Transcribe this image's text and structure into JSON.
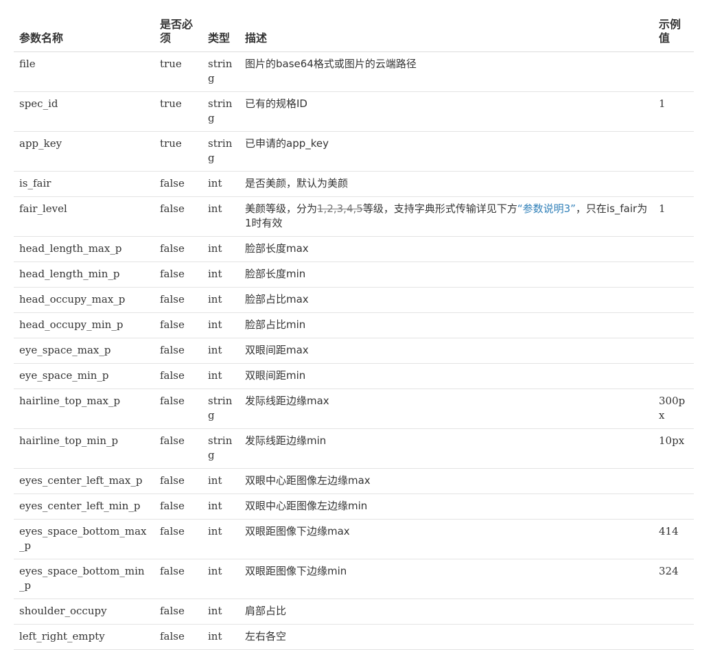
{
  "headers": {
    "name": "参数名称",
    "required": "是否必须",
    "type": "类型",
    "description": "描述",
    "example": "示例值"
  },
  "rows": [
    {
      "name": "file",
      "required": "true",
      "type": "string",
      "description": "图片的base64格式或图片的云端路径",
      "example": ""
    },
    {
      "name": "spec_id",
      "required": "true",
      "type": "string",
      "description": "已有的规格ID",
      "example": "1"
    },
    {
      "name": "app_key",
      "required": "true",
      "type": "string",
      "description": "已申请的app_key",
      "example": ""
    },
    {
      "name": "is_fair",
      "required": "false",
      "type": "int",
      "description": "是否美颜，默认为美颜",
      "example": ""
    },
    {
      "name": "fair_level",
      "required": "false",
      "type": "int",
      "description": "",
      "example": "1"
    },
    {
      "name": "head_length_max_p",
      "required": "false",
      "type": "int",
      "description": "脸部长度max",
      "example": ""
    },
    {
      "name": "head_length_min_p",
      "required": "false",
      "type": "int",
      "description": "脸部长度min",
      "example": ""
    },
    {
      "name": "head_occupy_max_p",
      "required": "false",
      "type": "int",
      "description": "脸部占比max",
      "example": ""
    },
    {
      "name": "head_occupy_min_p",
      "required": "false",
      "type": "int",
      "description": "脸部占比min",
      "example": ""
    },
    {
      "name": "eye_space_max_p",
      "required": "false",
      "type": "int",
      "description": "双眼间距max",
      "example": ""
    },
    {
      "name": "eye_space_min_p",
      "required": "false",
      "type": "int",
      "description": "双眼间距min",
      "example": ""
    },
    {
      "name": "hairline_top_max_p",
      "required": "false",
      "type": "string",
      "description": "发际线距边缘max",
      "example": "300px"
    },
    {
      "name": "hairline_top_min_p",
      "required": "false",
      "type": "string",
      "description": "发际线距边缘min",
      "example": "10px"
    },
    {
      "name": "eyes_center_left_max_p",
      "required": "false",
      "type": "int",
      "description": "双眼中心距图像左边缘max",
      "example": ""
    },
    {
      "name": "eyes_center_left_min_p",
      "required": "false",
      "type": "int",
      "description": "双眼中心距图像左边缘min",
      "example": ""
    },
    {
      "name": "eyes_space_bottom_max_p",
      "required": "false",
      "type": "int",
      "description": "双眼距图像下边缘max",
      "example": "414"
    },
    {
      "name": "eyes_space_bottom_min_p",
      "required": "false",
      "type": "int",
      "description": "双眼距图像下边缘min",
      "example": "324"
    },
    {
      "name": "shoulder_occupy",
      "required": "false",
      "type": "int",
      "description": "肩部占比",
      "example": ""
    },
    {
      "name": "left_right_empty",
      "required": "false",
      "type": "int",
      "description": "左右各空",
      "example": ""
    }
  ],
  "fair_level_description": {
    "prefix": "美颜等级，分为",
    "struck": "1,2,3,4,5",
    "middle": "等级，支持字典形式传输详见下方",
    "link": "“参数说明3”",
    "suffix": "，只在is_fair为1时有效"
  }
}
